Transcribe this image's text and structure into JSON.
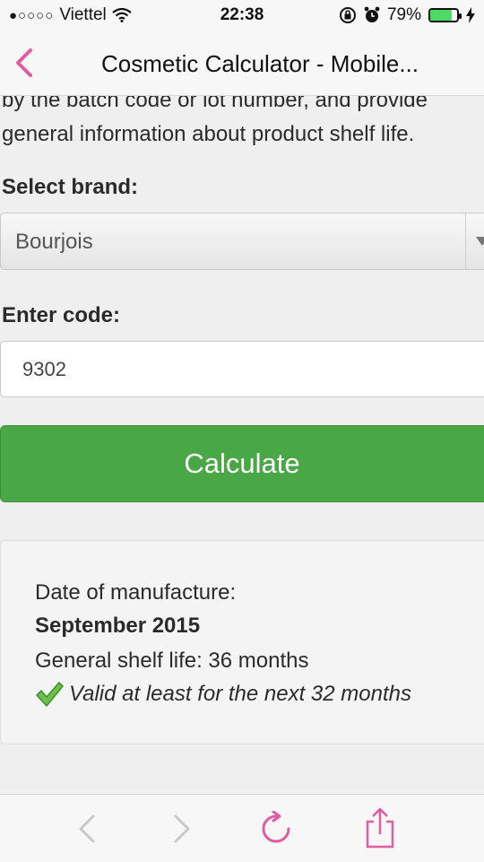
{
  "status_bar": {
    "carrier": "Viettel",
    "time": "22:38",
    "battery_percent": "79%",
    "battery_level": 0.79,
    "icons": [
      "signal-dots-icon",
      "wifi-icon",
      "rotation-lock-icon",
      "alarm-icon",
      "battery-icon",
      "charging-icon"
    ]
  },
  "nav": {
    "title": "Cosmetic Calculator - Mobile...",
    "back_icon": "chevron-left-icon",
    "accent": "#e05ea0"
  },
  "intro": {
    "line1": "by the batch code or lot number, and provide",
    "line2": "general information about product shelf life."
  },
  "brand": {
    "label": "Select brand:",
    "selected": "Bourjois"
  },
  "code": {
    "label": "Enter code:",
    "value": "9302"
  },
  "calculate_button": {
    "label": "Calculate",
    "color": "#4aa746"
  },
  "result": {
    "manufacture_label": "Date of manufacture:",
    "manufacture_date": "September 2015",
    "shelf_life": "General shelf life: 36 months",
    "validity": "Valid at least for the next 32 months"
  },
  "toolbar": {
    "icons": [
      "back-icon",
      "forward-icon",
      "reload-icon",
      "share-icon"
    ]
  }
}
